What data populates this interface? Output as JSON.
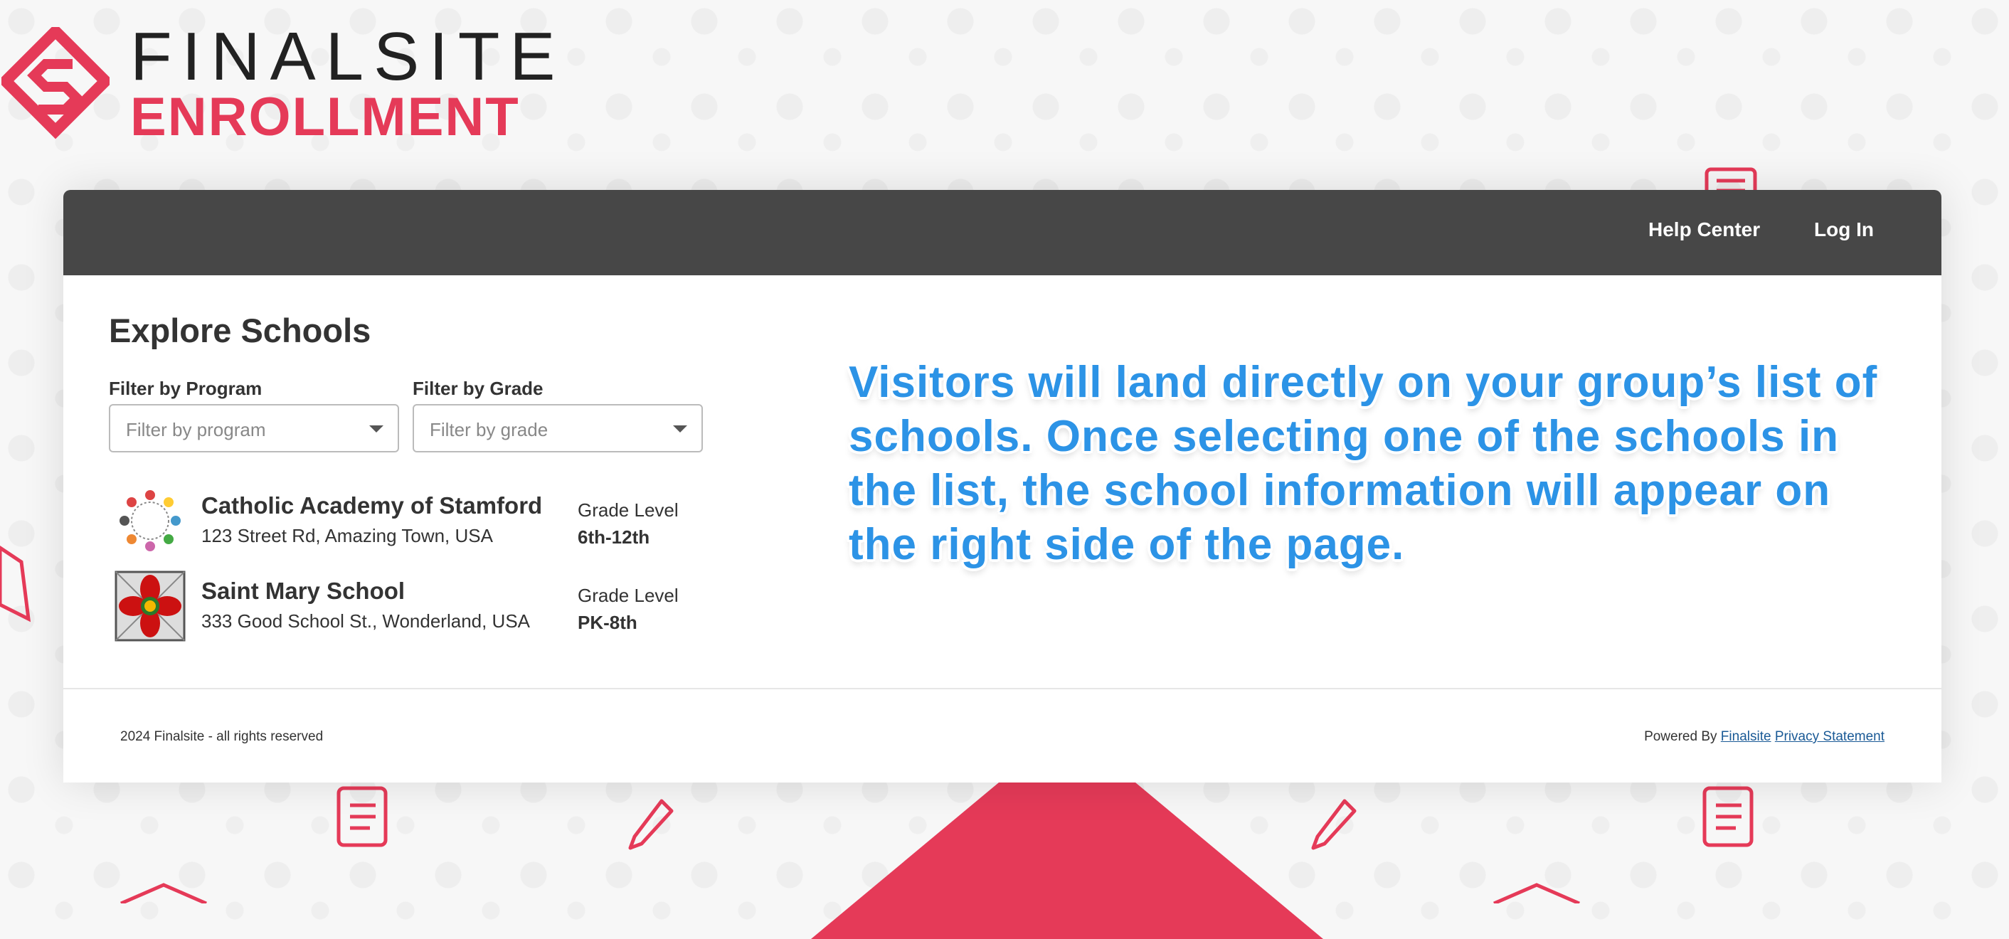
{
  "brand": {
    "word1": "FINALSITE",
    "word2": "ENROLLMENT",
    "accent_color": "#e53a58"
  },
  "nav": {
    "help_center": "Help Center",
    "log_in": "Log In"
  },
  "page": {
    "title": "Explore Schools"
  },
  "filters": {
    "program": {
      "label": "Filter by Program",
      "placeholder": "Filter by program"
    },
    "grade": {
      "label": "Filter by Grade",
      "placeholder": "Filter by grade"
    }
  },
  "schools": [
    {
      "name": "Catholic Academy of Stamford",
      "address": "123 Street Rd, Amazing Town, USA",
      "grade_label": "Grade Level",
      "grade_value": "6th-12th",
      "logo_icon": "children-circle-logo-icon"
    },
    {
      "name": "Saint Mary School",
      "address": "333 Good School St., Wonderland, USA",
      "grade_label": "Grade Level",
      "grade_value": "PK-8th",
      "logo_icon": "red-flower-logo-icon"
    }
  ],
  "callout": {
    "text": "Visitors will land directly on your group’s list of schools. Once selecting one of the schools in the list, the school information will appear on the right side of the page."
  },
  "footer": {
    "copyright": "2024 Finalsite - all rights reserved",
    "powered_by": "Powered By",
    "finalsite_link": "Finalsite",
    "privacy_link": "Privacy Statement"
  }
}
